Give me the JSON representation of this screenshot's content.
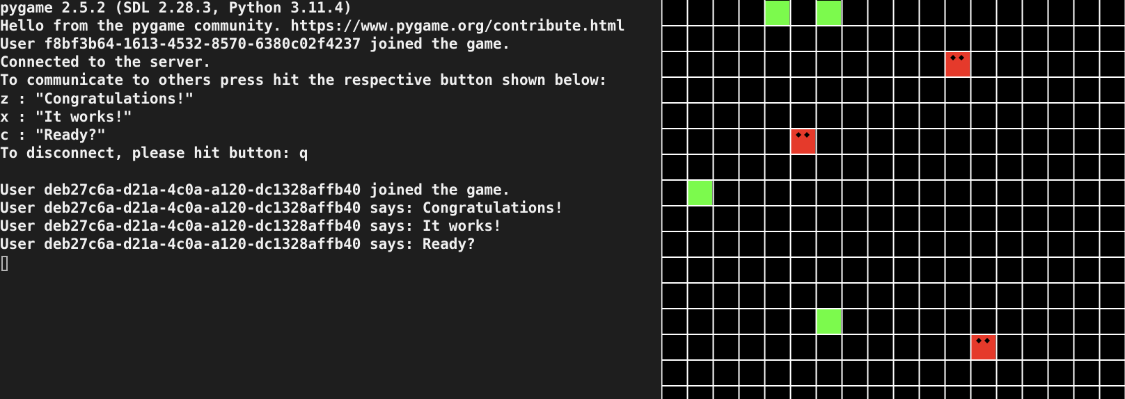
{
  "terminal": {
    "lines": [
      "pygame 2.5.2 (SDL 2.28.3, Python 3.11.4)",
      "Hello from the pygame community. https://www.pygame.org/contribute.html",
      "User f8bf3b64-1613-4532-8570-6380c02f4237 joined the game.",
      "Connected to the server.",
      "To communicate to others press hit the respective button shown below:",
      "z : \"Congratulations!\"",
      "x : \"It works!\"",
      "c : \"Ready?\"",
      "To disconnect, please hit button: q",
      "",
      "User deb27c6a-d21a-4c0a-a120-dc1328affb40 joined the game.",
      "User deb27c6a-d21a-4c0a-a120-dc1328affb40 says: Congratulations!",
      "User deb27c6a-d21a-4c0a-a120-dc1328affb40 says: It works!",
      "User deb27c6a-d21a-4c0a-a120-dc1328affb40 says: Ready?"
    ]
  },
  "game": {
    "colors": {
      "background": "#000000",
      "grid_lines": "#ffffff",
      "green_player": "#7cfa4d",
      "red_player": "#e53a2b",
      "eyes": "#000000"
    },
    "green_squares": [
      {
        "col": 4,
        "row": 0
      },
      {
        "col": 6,
        "row": 0
      },
      {
        "col": 1,
        "row": 7
      },
      {
        "col": 6,
        "row": 12
      }
    ],
    "red_squares": [
      {
        "col": 11,
        "row": 2
      },
      {
        "col": 5,
        "row": 5
      },
      {
        "col": 12,
        "row": 13
      }
    ]
  }
}
